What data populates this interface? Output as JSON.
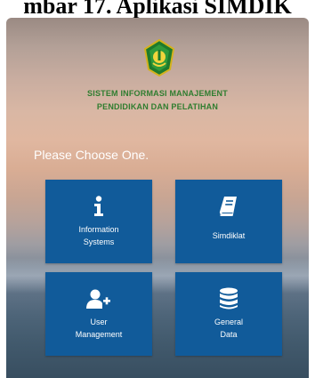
{
  "document": {
    "heading": "mbar 17. Aplikasi SIMDIK"
  },
  "header": {
    "org_line1": "SISTEM INFORMASI MANAJEMENT",
    "org_line2": "PENDIDIKAN DAN PELATIHAN",
    "logo_icon": "ministry-emblem-icon"
  },
  "main": {
    "prompt": "Please Choose One.",
    "tiles": [
      {
        "line1": "Information",
        "line2": "Systems",
        "icon": "info-icon"
      },
      {
        "line1": "Simdiklat",
        "icon": "book-icon"
      },
      {
        "line1": "User",
        "line2": "Management",
        "icon": "user-add-icon"
      },
      {
        "line1": "General",
        "line2": "Data",
        "icon": "database-icon"
      }
    ]
  },
  "colors": {
    "tile_bg": "#115b9a",
    "title_green": "#2f7d2f"
  }
}
